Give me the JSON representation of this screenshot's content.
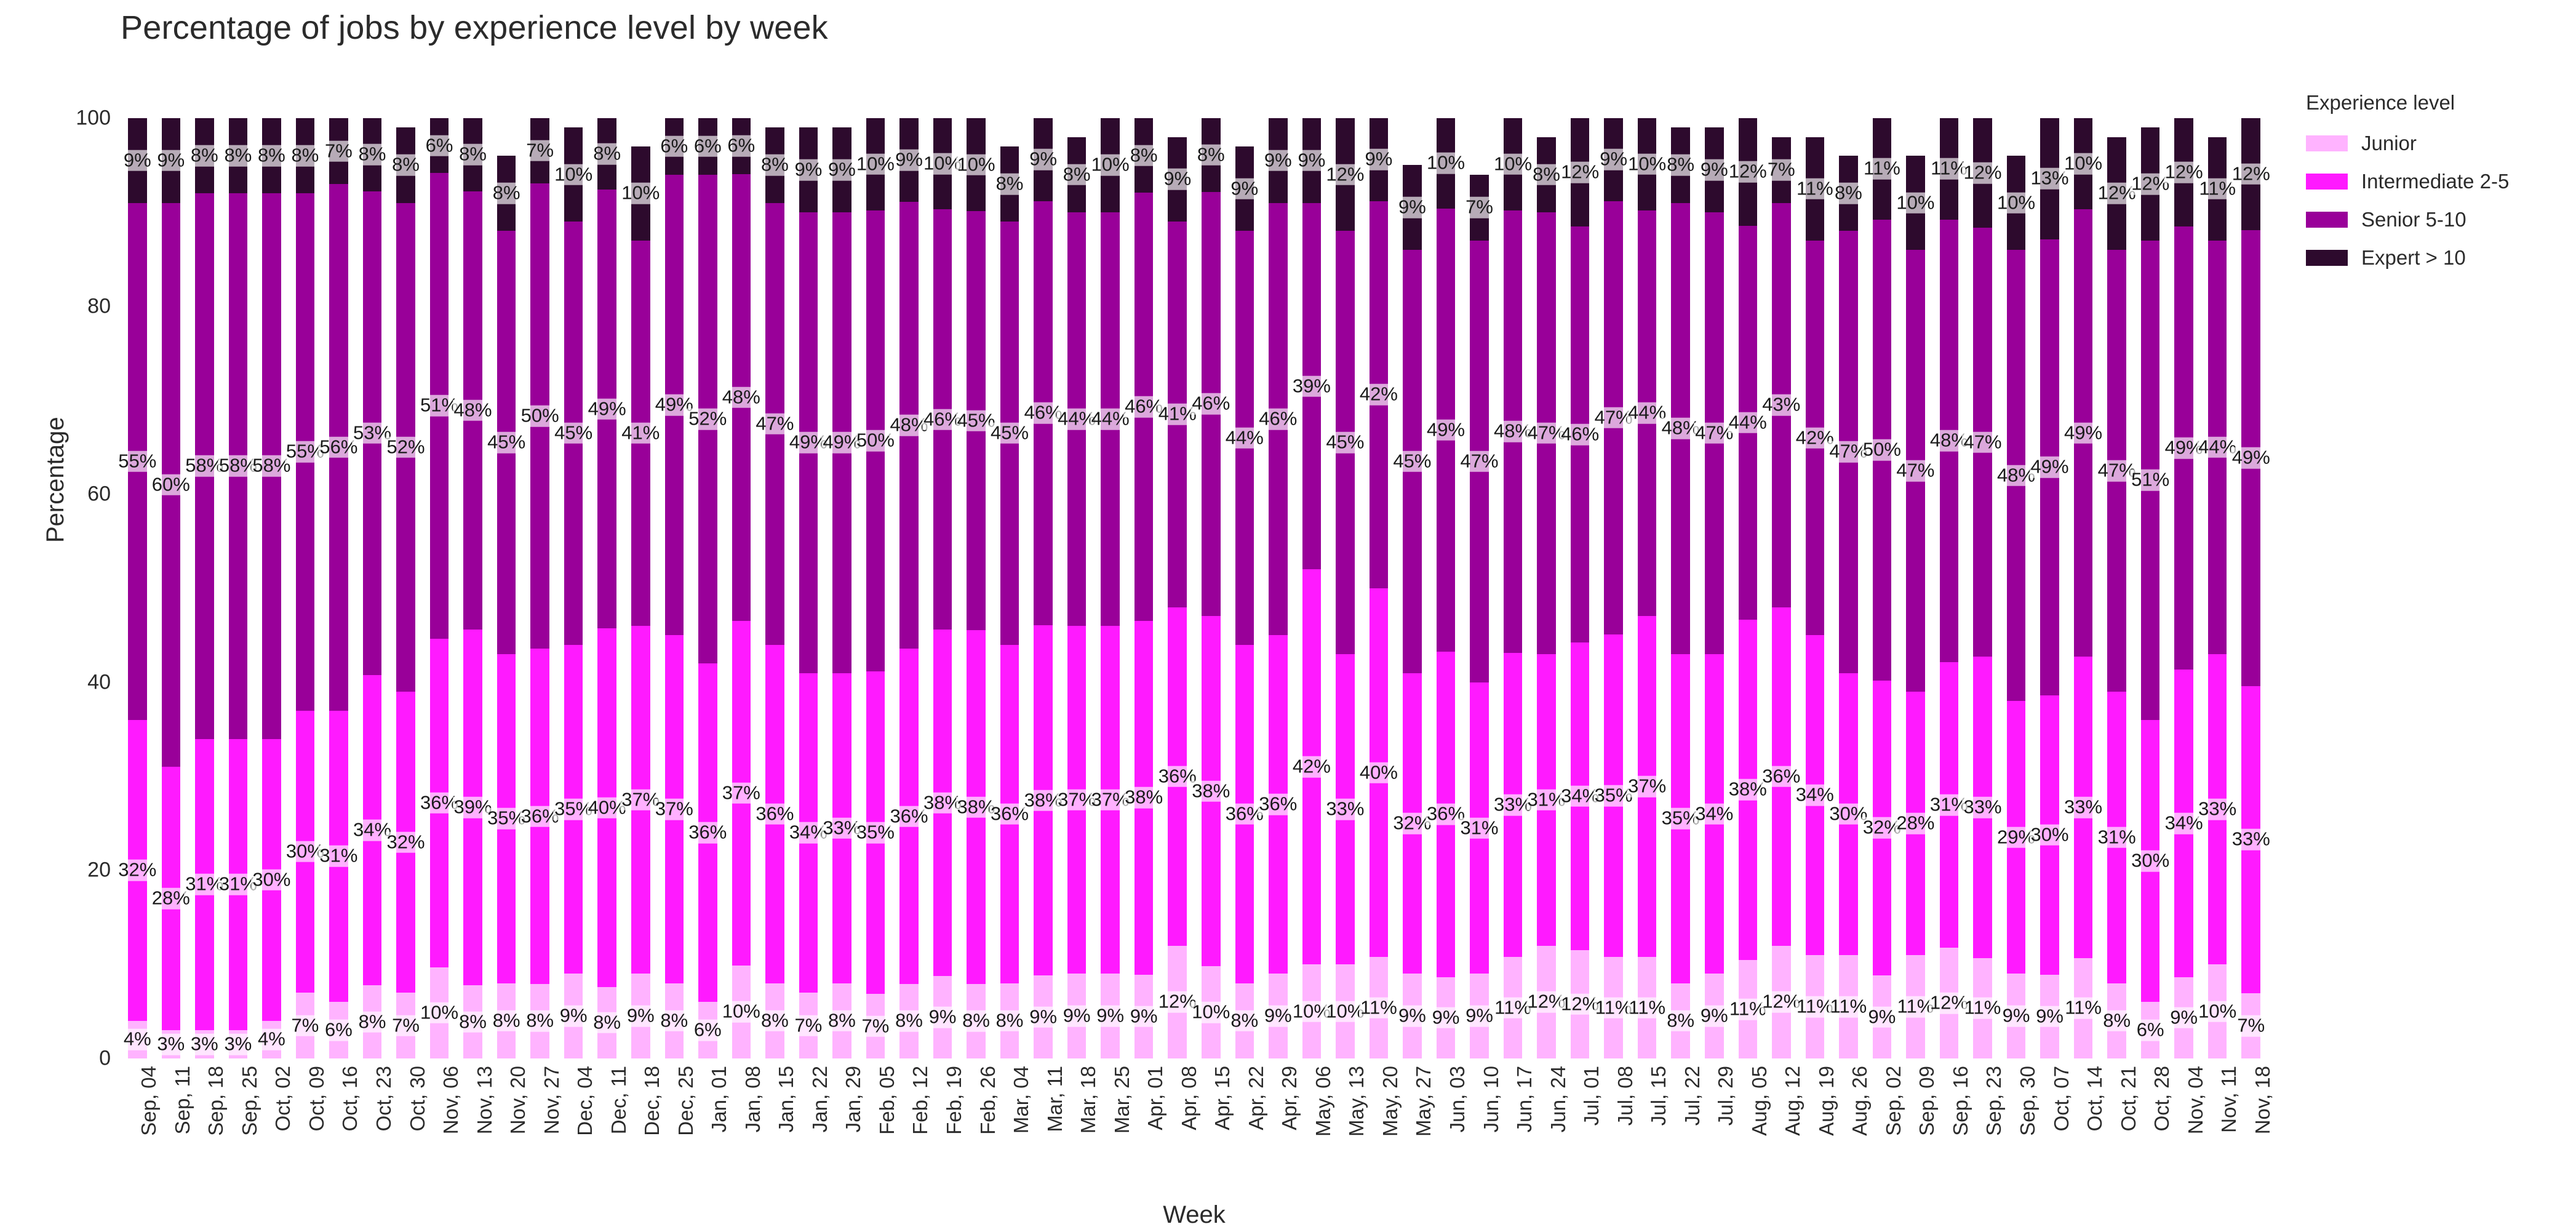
{
  "chart_data": {
    "type": "bar",
    "stacked": true,
    "normalized_percent": true,
    "title": "Percentage of jobs by experience level by week",
    "xlabel": "Week",
    "ylabel": "Percentage",
    "ylim": [
      0,
      100
    ],
    "yticks": [
      0,
      20,
      40,
      60,
      80,
      100
    ],
    "grid": false,
    "legend_title": "Experience level",
    "legend_position": "right",
    "colors": {
      "junior": "#FFB3FF",
      "intermediate": "#FF1AFF",
      "senior": "#990099",
      "expert": "#2D0A2D"
    },
    "categories": [
      "Sep, 04",
      "Sep, 11",
      "Sep, 18",
      "Sep, 25",
      "Oct, 02",
      "Oct, 09",
      "Oct, 16",
      "Oct, 23",
      "Oct, 30",
      "Nov, 06",
      "Nov, 13",
      "Nov, 20",
      "Nov, 27",
      "Dec, 04",
      "Dec, 11",
      "Dec, 18",
      "Dec, 25",
      "Jan, 01",
      "Jan, 08",
      "Jan, 15",
      "Jan, 22",
      "Jan, 29",
      "Feb, 05",
      "Feb, 12",
      "Feb, 19",
      "Feb, 26",
      "Mar, 04",
      "Mar, 11",
      "Mar, 18",
      "Mar, 25",
      "Apr, 01",
      "Apr, 08",
      "Apr, 15",
      "Apr, 22",
      "Apr, 29",
      "May, 06",
      "May, 13",
      "May, 20",
      "May, 27",
      "Jun, 03",
      "Jun, 10",
      "Jun, 17",
      "Jun, 24",
      "Jul, 01",
      "Jul, 08",
      "Jul, 15",
      "Jul, 22",
      "Jul, 29",
      "Aug, 05",
      "Aug, 12",
      "Aug, 19",
      "Aug, 26",
      "Sep, 02",
      "Sep, 09",
      "Sep, 16",
      "Sep, 23",
      "Sep, 30",
      "Oct, 07",
      "Oct, 14",
      "Oct, 21",
      "Oct, 28",
      "Nov, 04",
      "Nov, 11",
      "Nov, 18"
    ],
    "series": [
      {
        "name": "Junior",
        "key": "junior",
        "color": "#FFB3FF",
        "values": [
          4,
          3,
          3,
          3,
          4,
          7,
          6,
          8,
          7,
          10,
          8,
          8,
          8,
          9,
          8,
          9,
          8,
          6,
          10,
          8,
          7,
          8,
          7,
          8,
          9,
          8,
          8,
          9,
          9,
          9,
          9,
          12,
          10,
          8,
          9,
          10,
          10,
          11,
          9,
          9,
          9,
          11,
          12,
          12,
          11,
          11,
          8,
          9,
          11,
          12,
          11,
          11,
          9,
          11,
          12,
          11,
          9,
          9,
          11,
          8,
          6,
          9,
          10,
          7
        ]
      },
      {
        "name": "Intermediate 2-5",
        "key": "intermediate",
        "color": "#FF1AFF",
        "values": [
          32,
          28,
          31,
          31,
          30,
          30,
          31,
          34,
          32,
          36,
          39,
          35,
          36,
          35,
          40,
          37,
          37,
          36,
          37,
          36,
          34,
          33,
          35,
          36,
          38,
          38,
          36,
          38,
          37,
          37,
          38,
          36,
          38,
          36,
          36,
          42,
          33,
          40,
          32,
          36,
          31,
          33,
          31,
          34,
          35,
          37,
          35,
          34,
          38,
          36,
          34,
          30,
          32,
          28,
          31,
          33,
          29,
          30,
          33,
          31,
          30,
          34,
          33,
          33
        ]
      },
      {
        "name": "Senior 5-10",
        "key": "senior",
        "color": "#990099",
        "values": [
          55,
          60,
          58,
          58,
          58,
          55,
          56,
          53,
          52,
          51,
          48,
          45,
          50,
          45,
          49,
          41,
          49,
          52,
          48,
          47,
          49,
          49,
          50,
          48,
          46,
          45,
          45,
          46,
          44,
          44,
          46,
          41,
          46,
          44,
          46,
          39,
          45,
          42,
          45,
          49,
          47,
          48,
          47,
          46,
          47,
          44,
          48,
          47,
          44,
          43,
          42,
          47,
          50,
          47,
          48,
          47,
          48,
          49,
          49,
          47,
          51,
          49,
          44,
          49
        ]
      },
      {
        "name": "Expert > 10",
        "key": "expert",
        "color": "#2D0A2D",
        "values": [
          9,
          9,
          8,
          8,
          8,
          8,
          7,
          8,
          8,
          6,
          8,
          8,
          7,
          10,
          8,
          10,
          6,
          6,
          6,
          8,
          9,
          9,
          10,
          9,
          10,
          10,
          8,
          9,
          8,
          10,
          8,
          9,
          8,
          9,
          9,
          9,
          12,
          9,
          9,
          10,
          7,
          10,
          8,
          12,
          9,
          10,
          8,
          9,
          12,
          7,
          11,
          8,
          11,
          10,
          11,
          12,
          10,
          13,
          10,
          12,
          12,
          12,
          11,
          12
        ]
      }
    ]
  }
}
